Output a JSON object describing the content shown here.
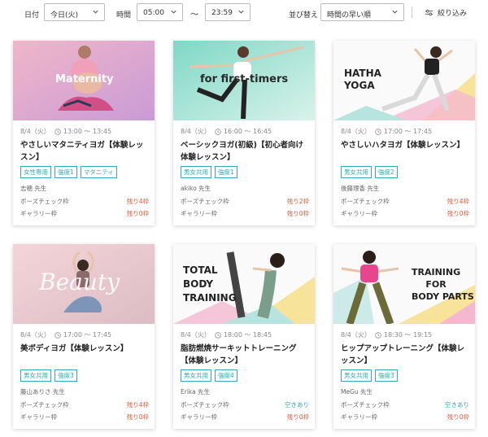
{
  "filters": {
    "date_label": "日付",
    "date_value": "今日(火)",
    "time_label": "時間",
    "time_from": "05:00",
    "time_separator": "〜",
    "time_to": "23:59",
    "sort_label": "並び替え",
    "sort_value": "時間の早い順",
    "refine_label": "絞り込み"
  },
  "cards": [
    {
      "image_text": "Maternity",
      "date": "8/4（火）",
      "time": "13:00 〜 13:45",
      "title": "やさしいマタニティヨガ【体験レッスン】",
      "tags": [
        "女性専用",
        "強度1",
        "マタニティ"
      ],
      "teacher": "志穂 先生",
      "slots": [
        {
          "label": "ポーズチェック枠",
          "status": "残り4枠"
        },
        {
          "label": "ギャラリー枠",
          "status": "残り0枠"
        }
      ]
    },
    {
      "image_text": "for first-timers",
      "date": "8/4（火）",
      "time": "16:00 〜 16:45",
      "title": "ベーシックヨガ(初級)【初心者向け体験レッスン】",
      "tags": [
        "男女共用",
        "強度1"
      ],
      "teacher": "akiko 先生",
      "slots": [
        {
          "label": "ポーズチェック枠",
          "status": "残り2枠"
        },
        {
          "label": "ギャラリー枠",
          "status": "残り0枠"
        }
      ]
    },
    {
      "image_text_lines": [
        "HATHA",
        "YOGA"
      ],
      "date": "8/4（火）",
      "time": "17:00 〜 17:45",
      "title": "やさしいハタヨガ【体験レッスン】",
      "tags": [
        "男女共用",
        "強度2"
      ],
      "teacher": "後藤理香 先生",
      "slots": [
        {
          "label": "ポーズチェック枠",
          "status": "残り4枠"
        },
        {
          "label": "ギャラリー枠",
          "status": "残り0枠"
        }
      ]
    },
    {
      "image_text": "Beauty",
      "date": "8/4（火）",
      "time": "17:00 〜 17:45",
      "title": "美ボディヨガ【体験レッスン】",
      "tags": [
        "男女共用",
        "強度3"
      ],
      "teacher": "藤山ありさ 先生",
      "slots": [
        {
          "label": "ポーズチェック枠",
          "status": "残り4枠"
        },
        {
          "label": "ギャラリー枠",
          "status": "残り0枠"
        }
      ]
    },
    {
      "image_text_lines": [
        "TOTAL",
        "BODY",
        "TRAINING"
      ],
      "date": "8/4（火）",
      "time": "18:00 〜 18:45",
      "title": "脂肪燃焼サーキットトレーニング【体験レッスン】",
      "tags": [
        "男女共用",
        "強度4"
      ],
      "teacher": "Erika 先生",
      "slots": [
        {
          "label": "ポーズチェック枠",
          "status": "空きあり"
        },
        {
          "label": "ギャラリー枠",
          "status": "残り0枠"
        }
      ]
    },
    {
      "image_text_lines": [
        "TRAINING",
        "FOR",
        "BODY PARTS"
      ],
      "date": "8/4（火）",
      "time": "18:30 〜 19:15",
      "title": "ヒップアップトレーニング【体験レッスン】",
      "tags": [
        "男女共用",
        "強度3"
      ],
      "teacher": "MeGu 先生",
      "slots": [
        {
          "label": "ポーズチェック枠",
          "status": "空きあり"
        },
        {
          "label": "ギャラリー枠",
          "status": "残り0枠"
        }
      ]
    }
  ],
  "colors": {
    "accent": "#3aa7b5",
    "remaining": "#e05a3a",
    "available": "#3aa7b5"
  }
}
